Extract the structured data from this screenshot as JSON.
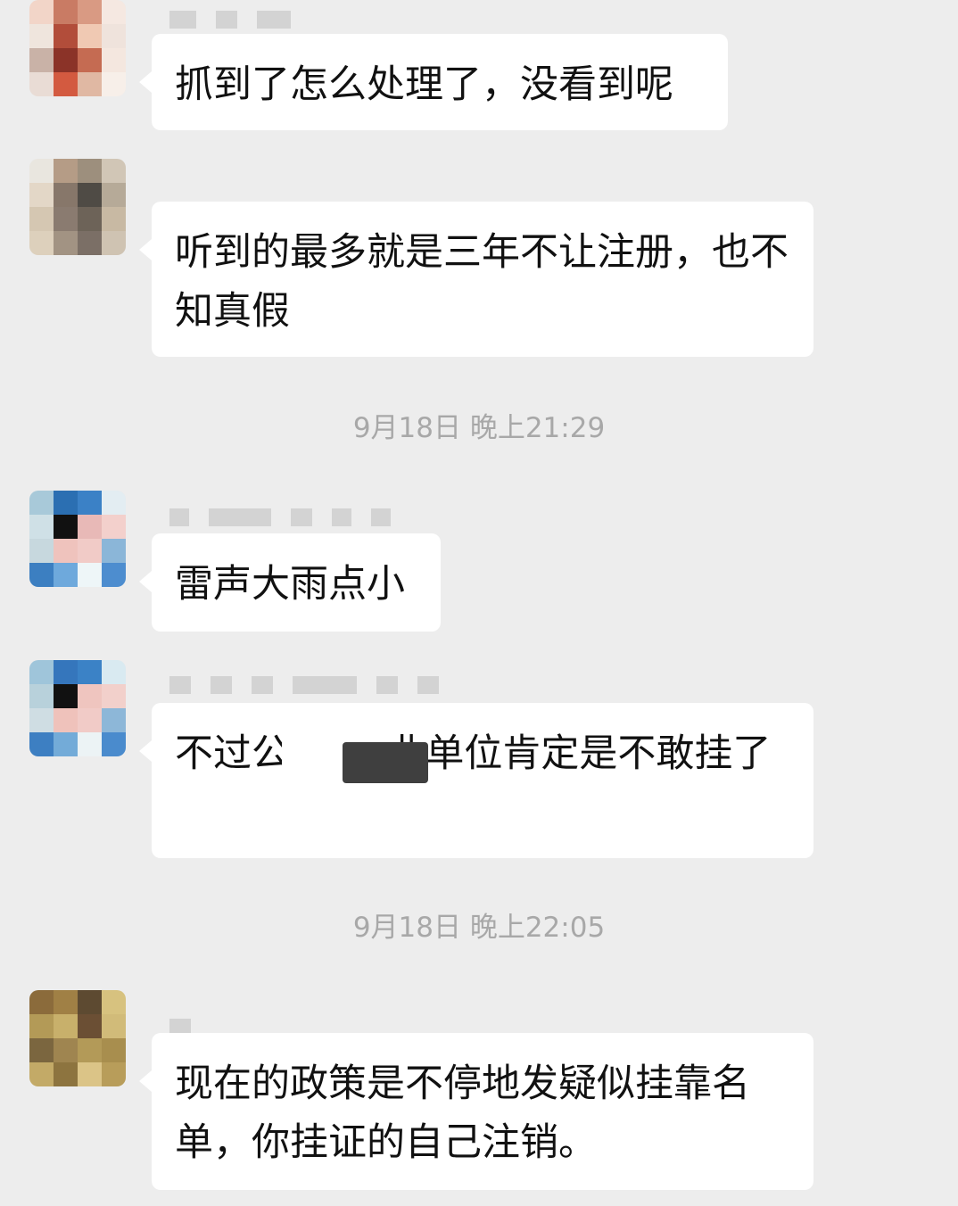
{
  "messages": [
    {
      "text": "抓到了怎么处理了，没看到呢",
      "avatar_colors": [
        "#f2d5c8",
        "#c97b64",
        "#d99a83",
        "#f5e8e1",
        "#efe5dd",
        "#b24d3a",
        "#f0c9b3",
        "#efe3dc",
        "#c9b2a7",
        "#8b3328",
        "#c56b52",
        "#f4e7df",
        "#e9dcd5",
        "#d35a40",
        "#e0b8a3",
        "#f7efe9"
      ]
    },
    {
      "text": "听到的最多就是三年不让注册，也不知真假",
      "avatar_colors": [
        "#e9e6df",
        "#b59c86",
        "#9d8f7d",
        "#d1c6b6",
        "#e3d7c7",
        "#87776a",
        "#4f4b45",
        "#b6aa98",
        "#d5c7b2",
        "#8a7b70",
        "#6d6358",
        "#c8b9a3",
        "#ddd0bc",
        "#a29383",
        "#7b6f66",
        "#cfc3b2"
      ]
    },
    {
      "time": "9月18日 晚上21:29"
    },
    {
      "text": "雷声大雨点小",
      "avatar_colors": [
        "#a8c9d9",
        "#2b6fb2",
        "#3b81c6",
        "#e3edf2",
        "#cfe0e6",
        "#111111",
        "#e8b9b7",
        "#f3d0cc",
        "#c7d8de",
        "#efc3bd",
        "#f1cbc7",
        "#8bb6d8",
        "#3c7fc1",
        "#6ea9dc",
        "#eef6f8",
        "#4d8dcf"
      ]
    },
    {
      "text": "不过公        业单位肯定是不敢挂了",
      "avatar_colors": [
        "#9fc5da",
        "#3576bc",
        "#3b82c6",
        "#d9eaf1",
        "#b8d1db",
        "#111111",
        "#efc5bf",
        "#f2d0cb",
        "#cfdde3",
        "#efc2bb",
        "#f1cbc7",
        "#8db7d8",
        "#3d7fc2",
        "#73abd8",
        "#ecf3f5",
        "#4a8bcd"
      ]
    },
    {
      "time": "9月18日 晚上22:05"
    },
    {
      "text": "现在的政策是不停地发疑似挂靠名单，你挂证的自己注销。",
      "avatar_colors": [
        "#8b6b3b",
        "#a08045",
        "#5d4a31",
        "#d7c27f",
        "#b39a57",
        "#c8b06b",
        "#6b4f34",
        "#d1bb79",
        "#7b663f",
        "#9f8550",
        "#b39a58",
        "#a88e4e",
        "#c3aa67",
        "#8d743f",
        "#dbc487",
        "#b89d5a"
      ]
    }
  ]
}
